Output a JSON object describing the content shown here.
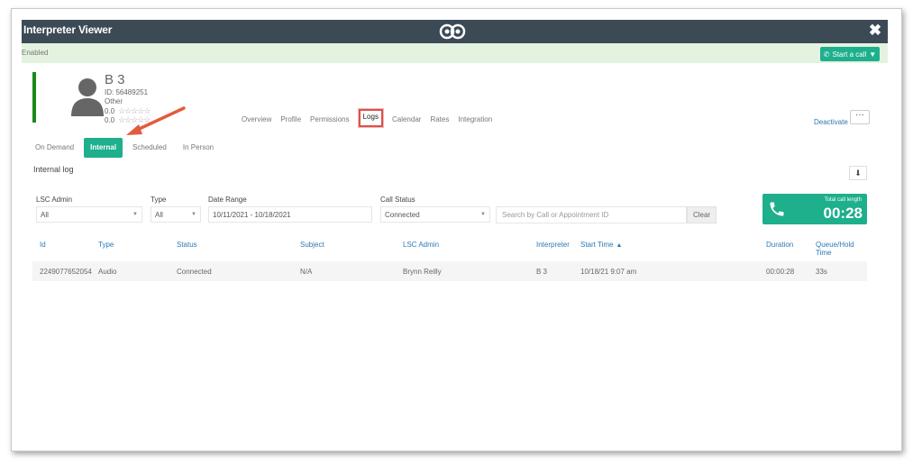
{
  "window": {
    "title": "Interpreter Viewer",
    "close_label": "✖"
  },
  "status": {
    "text": "Enabled",
    "start_call_label": "Start a call"
  },
  "profile": {
    "name": "B 3",
    "id_text": "ID: 56489251",
    "category": "Other",
    "rating1_value": "0.0",
    "rating2_value": "0.0",
    "stars": "☆☆☆☆☆"
  },
  "main_tabs": [
    {
      "label": "Overview"
    },
    {
      "label": "Profile"
    },
    {
      "label": "Permissions"
    },
    {
      "label": "Logs"
    },
    {
      "label": "Calendar"
    },
    {
      "label": "Rates"
    },
    {
      "label": "Integration"
    }
  ],
  "actions": {
    "deactivate_label": "Deactivate",
    "more_label": "···"
  },
  "sub_tabs": [
    {
      "label": "On Demand"
    },
    {
      "label": "Internal"
    },
    {
      "label": "Scheduled"
    },
    {
      "label": "In Person"
    }
  ],
  "section": {
    "title": "Internal log",
    "download_label": "⬇"
  },
  "filters": {
    "lsc_admin_label": "LSC Admin",
    "lsc_admin_value": "All",
    "type_label": "Type",
    "type_value": "All",
    "date_range_label": "Date Range",
    "date_range_value": "10/11/2021 - 10/18/2021",
    "call_status_label": "Call Status",
    "call_status_value": "Connected",
    "search_placeholder": "Search by Call or Appointment ID",
    "clear_label": "Clear"
  },
  "total": {
    "label": "Total call length",
    "value": "00:28"
  },
  "table": {
    "headers": {
      "id": "Id",
      "type": "Type",
      "status": "Status",
      "subject": "Subject",
      "lsc_admin": "LSC Admin",
      "interpreter": "Interpreter",
      "start_time": "Start Time",
      "duration": "Duration",
      "queue_hold_line1": "Queue/Hold",
      "queue_hold_line2": "Time"
    },
    "rows": [
      {
        "id": "2249077652054",
        "type": "Audio",
        "status": "Connected",
        "subject": "N/A",
        "lsc_admin": "Brynn Reilly",
        "interpreter": "B 3",
        "start_time": "10/18/21 9:07 am",
        "duration": "00:00:28",
        "queue_hold": "33s"
      }
    ]
  },
  "colors": {
    "titlebar": "#3b4a55",
    "accent": "#1eaf8c",
    "status_bg": "#e4f3e0",
    "link": "#2a7ab8",
    "highlight": "#d9534f",
    "profile_bar": "#1b8a1b"
  }
}
